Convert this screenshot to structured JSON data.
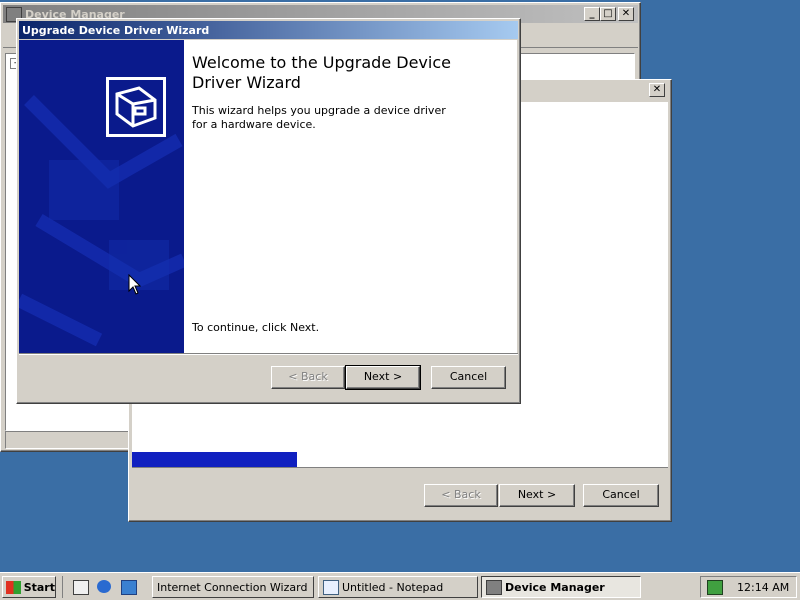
{
  "desktop": {
    "background": "#3a6ea5"
  },
  "device_manager": {
    "title": "Device Manager",
    "tree_toggle": "-"
  },
  "back_wizard": {
    "back_label": "< Back",
    "next_label": "Next >",
    "cancel_label": "Cancel"
  },
  "upgrade_wizard": {
    "title": "Upgrade Device Driver Wizard",
    "heading": "Welcome to the Upgrade Device Driver Wizard",
    "description": "This wizard helps you upgrade a device driver for a hardware device.",
    "continue_text": "To continue, click Next.",
    "back_label": "< Back",
    "next_label": "Next >",
    "cancel_label": "Cancel"
  },
  "taskbar": {
    "start_label": "Start",
    "quick_launch": [
      "show-desktop-icon",
      "internet-explorer-icon",
      "outlook-express-icon"
    ],
    "tasks": [
      {
        "label": "Internet Connection Wizard"
      },
      {
        "label": "Untitled - Notepad"
      },
      {
        "label": "Device Manager"
      }
    ],
    "clock": "12:14 AM"
  },
  "colors": {
    "active_title": "#0a246a",
    "inactive_title": "#808080",
    "wizard_banner": "#0a1a8c"
  }
}
